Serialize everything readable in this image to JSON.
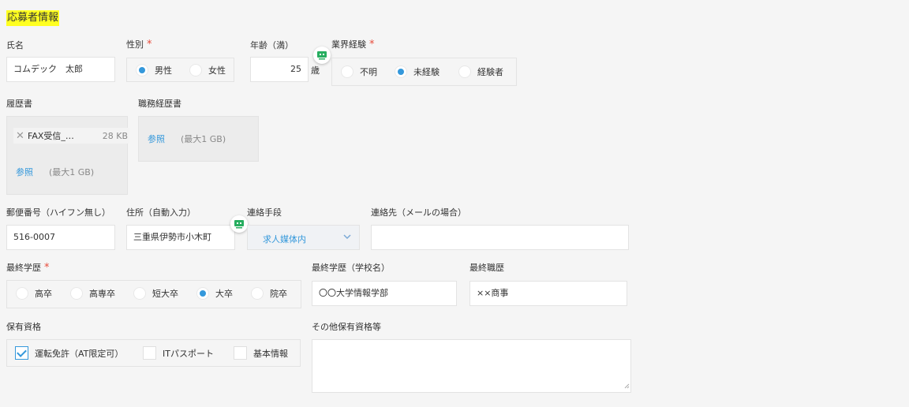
{
  "section_title": "応募者情報",
  "fields": {
    "name": {
      "label": "氏名",
      "value": "コムデック　太郎"
    },
    "gender": {
      "label": "性別",
      "options": [
        "男性",
        "女性"
      ],
      "selected": "男性"
    },
    "age": {
      "label": "年齢（満）",
      "value": "25",
      "unit": "歳"
    },
    "experience": {
      "label": "業界経験",
      "options": [
        "不明",
        "未経験",
        "経験者"
      ],
      "selected": "未経験"
    },
    "resume": {
      "label": "履歴書",
      "file_name": "FAX受信_…",
      "file_size": "28 KB",
      "browse_label": "参照",
      "max_size": "(最大1 GB)"
    },
    "career_doc": {
      "label": "職務経歴書",
      "browse_label": "参照",
      "max_size": "(最大1 GB)"
    },
    "postal": {
      "label": "郵便番号（ハイフン無し）",
      "value": "516-0007"
    },
    "address": {
      "label": "住所（自動入力）",
      "value": "三重県伊勢市小木町"
    },
    "contact_method": {
      "label": "連絡手段",
      "value": "求人媒体内"
    },
    "contact": {
      "label": "連絡先（メールの場合）",
      "value": ""
    },
    "education": {
      "label": "最終学歴",
      "options": [
        "高卒",
        "高専卒",
        "短大卒",
        "大卒",
        "院卒"
      ],
      "selected": "大卒"
    },
    "school": {
      "label": "最終学歴（学校名）",
      "value": "〇〇大学情報学部"
    },
    "last_job": {
      "label": "最終職歴",
      "value": "××商事"
    },
    "qualifications": {
      "label": "保有資格",
      "options": [
        {
          "label": "運転免許（AT限定可）",
          "checked": true
        },
        {
          "label": "ITパスポート",
          "checked": false
        },
        {
          "label": "基本情報",
          "checked": false
        }
      ]
    },
    "other_quals": {
      "label": "その他保有資格等",
      "value": ""
    }
  },
  "colors": {
    "accent": "#3498db",
    "required": "#e74c3c",
    "highlight": "#ffff20",
    "bot": "#27ae60"
  },
  "icons": {
    "assistant": "bot-icon",
    "remove": "close-icon",
    "dropdown": "chevron-down-icon",
    "resize": "resize-grip-icon"
  }
}
